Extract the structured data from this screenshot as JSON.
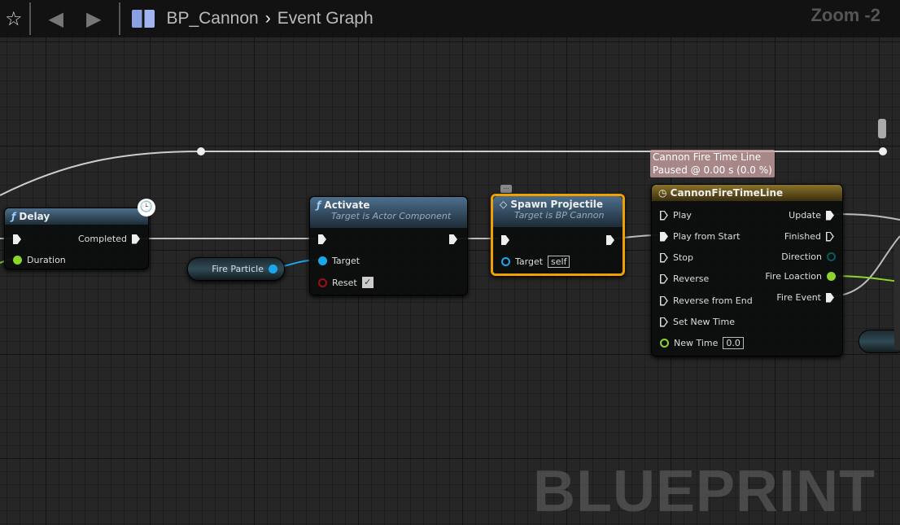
{
  "toolbar": {
    "breadcrumb_blueprint": "BP_Cannon",
    "breadcrumb_graph": "Event Graph",
    "zoom": "Zoom -2",
    "separator": "›"
  },
  "watermark": "BLUEPRINT",
  "tooltip": {
    "line1": "Cannon Fire Time Line",
    "line2": "Paused @ 0.00 s (0.0 %)"
  },
  "nodes": {
    "delay": {
      "title": "Delay",
      "out_completed": "Completed",
      "in_duration": "Duration"
    },
    "fire_particle": {
      "label": "Fire Particle"
    },
    "activate": {
      "title": "Activate",
      "subtitle": "Target is Actor Component",
      "target": "Target",
      "reset": "Reset",
      "reset_checked": true
    },
    "spawn": {
      "title": "Spawn Projectile",
      "subtitle": "Target is BP Cannon",
      "target": "Target",
      "target_value": "self"
    },
    "timeline": {
      "title": "CannonFireTimeLine",
      "inputs": [
        "Play",
        "Play from Start",
        "Stop",
        "Reverse",
        "Reverse from End",
        "Set New Time"
      ],
      "new_time": "New Time",
      "new_time_value": "0.0",
      "outputs": [
        "Update",
        "Finished",
        "Direction",
        "Fire Loaction",
        "Fire Event"
      ]
    }
  },
  "colors": {
    "exec": "#eeeeee",
    "float": "#8bd62b",
    "object": "#1aa7ec",
    "selected": "#f0a000",
    "timeline_header": "#7a6420"
  }
}
